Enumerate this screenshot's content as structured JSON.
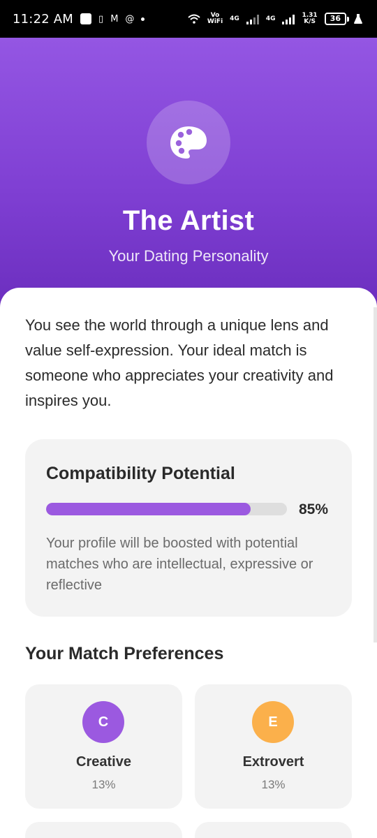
{
  "status_bar": {
    "time": "11:22 AM",
    "vowifi_top": "Vo",
    "vowifi_bottom": "WiFi",
    "net1": "4G",
    "net2": "4G",
    "speed_top": "1.31",
    "speed_bottom": "K/S",
    "battery": "36"
  },
  "hero": {
    "icon": "palette-icon",
    "title": "The Artist",
    "subtitle": "Your Dating Personality",
    "gradient_top": "#9456e3",
    "gradient_bottom": "#6a2dbd"
  },
  "description": "You see the world through a unique lens and value self-expression. Your ideal match is someone who appreciates your creativity and inspires you.",
  "compatibility": {
    "title": "Compatibility Potential",
    "value": 0.85,
    "value_label": "85%",
    "text": "Your profile will be boosted with potential matches who are intellectual, expressive or reflective",
    "bar_color": "#9b59e0"
  },
  "preferences": {
    "title": "Your Match Preferences",
    "items": [
      {
        "letter": "C",
        "name": "Creative",
        "percent": "13%",
        "color": "#9b59e0"
      },
      {
        "letter": "E",
        "name": "Extrovert",
        "percent": "13%",
        "color": "#fbb04b"
      }
    ]
  }
}
